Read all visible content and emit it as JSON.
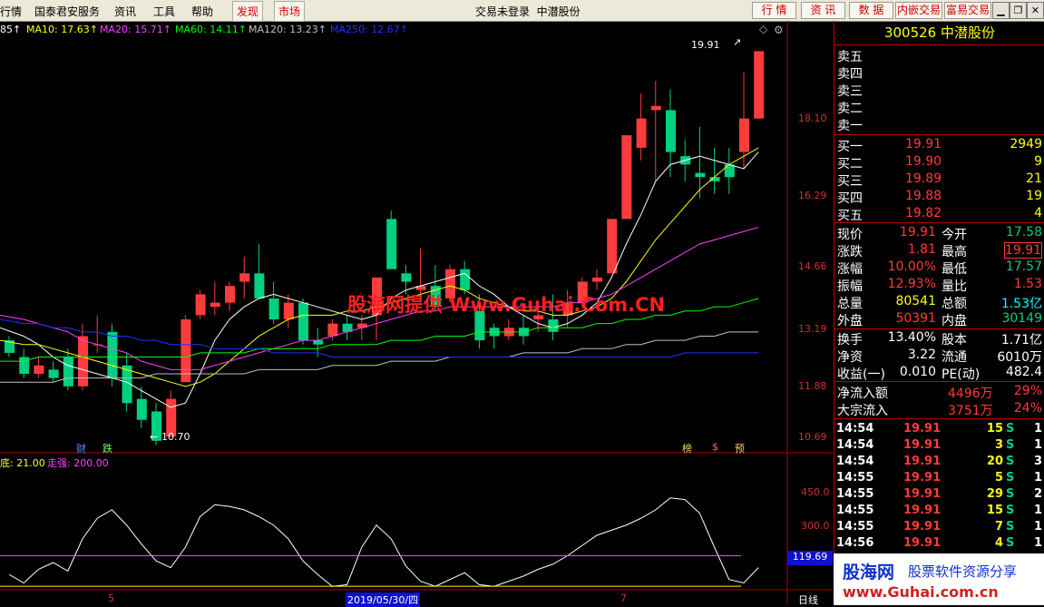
{
  "menu": {
    "items": [
      "行情",
      "国泰君安服务",
      "资讯",
      "工具",
      "帮助"
    ],
    "discover": "发现",
    "market": "市场",
    "title_status": "交易未登录",
    "title_stock": "中潜股份",
    "toolbar": [
      "行 情",
      "资 讯",
      "数 据",
      "内嵌交易",
      "富易交易"
    ]
  },
  "ma_legend": [
    {
      "label": "85↑",
      "color": "#ffffff"
    },
    {
      "label": "MA10: 17.63↑",
      "color": "#ffff00"
    },
    {
      "label": "MA20: 15.71↑",
      "color": "#ff40ff"
    },
    {
      "label": "MA60: 14.11↑",
      "color": "#00ff00"
    },
    {
      "label": "MA120: 13.23↑",
      "color": "#c0c0c0"
    },
    {
      "label": "MA250: 12.67↑",
      "color": "#2030ff"
    }
  ],
  "price_axis": [
    "18.10",
    "16.29",
    "14.66",
    "13.19",
    "11.88",
    "10.69"
  ],
  "annotations": {
    "high": "19.91",
    "low": "10.70",
    "cai": "财",
    "die": "跌",
    "bang": "榜",
    "s": "$",
    "yu": "预"
  },
  "watermark": "股海网提供 Www.Guhai.Com.CN",
  "indicator": {
    "label1": "底: 21.00",
    "label2": "走强: 200.00",
    "axis": [
      "450.0",
      "300.0"
    ],
    "current": "119.69"
  },
  "x_axis": {
    "mark1": "5",
    "date": "2019/05/30/四",
    "mark2": "7",
    "period": "日线"
  },
  "chart_data": {
    "type": "candlestick",
    "ohlc": [
      [
        13.0,
        13.1,
        12.6,
        12.7
      ],
      [
        12.6,
        12.8,
        12.1,
        12.2
      ],
      [
        12.2,
        12.6,
        12.1,
        12.4
      ],
      [
        12.3,
        12.5,
        12.0,
        12.1
      ],
      [
        12.6,
        12.8,
        11.8,
        11.9
      ],
      [
        11.9,
        13.4,
        11.8,
        13.1
      ],
      [
        12.9,
        13.6,
        12.7,
        12.9
      ],
      [
        13.2,
        13.4,
        11.9,
        12.1
      ],
      [
        12.4,
        12.7,
        11.3,
        11.5
      ],
      [
        11.6,
        11.9,
        10.9,
        11.1
      ],
      [
        11.3,
        11.5,
        10.5,
        10.6
      ],
      [
        10.7,
        11.8,
        10.7,
        11.6
      ],
      [
        12.0,
        13.6,
        12.0,
        13.5
      ],
      [
        13.6,
        14.2,
        13.5,
        14.1
      ],
      [
        13.8,
        14.4,
        13.6,
        13.9
      ],
      [
        13.9,
        14.4,
        13.7,
        14.3
      ],
      [
        14.4,
        15.0,
        14.0,
        14.6
      ],
      [
        14.6,
        15.3,
        14.5,
        14.0
      ],
      [
        14.0,
        14.4,
        13.4,
        13.5
      ],
      [
        13.5,
        14.1,
        13.3,
        13.9
      ],
      [
        13.9,
        14.0,
        12.9,
        13.0
      ],
      [
        13.0,
        13.3,
        12.6,
        12.9
      ],
      [
        13.1,
        13.5,
        13.0,
        13.4
      ],
      [
        13.4,
        13.6,
        13.0,
        13.2
      ],
      [
        13.3,
        13.6,
        13.0,
        13.4
      ],
      [
        13.6,
        14.5,
        13.0,
        14.5
      ],
      [
        15.9,
        16.1,
        14.7,
        14.7
      ],
      [
        14.6,
        14.8,
        14.1,
        14.4
      ],
      [
        14.2,
        15.2,
        14.0,
        14.3
      ],
      [
        14.3,
        14.8,
        13.7,
        13.8
      ],
      [
        14.0,
        14.8,
        13.9,
        14.7
      ],
      [
        14.7,
        14.9,
        14.1,
        14.2
      ],
      [
        13.7,
        14.1,
        12.8,
        13.0
      ],
      [
        13.3,
        13.4,
        12.8,
        13.1
      ],
      [
        13.1,
        13.5,
        13.0,
        13.3
      ],
      [
        13.3,
        13.6,
        12.9,
        13.1
      ],
      [
        13.5,
        13.9,
        13.2,
        13.6
      ],
      [
        13.5,
        14.1,
        13.0,
        13.2
      ],
      [
        13.6,
        14.2,
        13.3,
        13.9
      ],
      [
        13.9,
        14.5,
        13.8,
        14.4
      ],
      [
        14.4,
        14.7,
        14.2,
        14.5
      ],
      [
        14.6,
        15.9,
        14.6,
        15.9
      ],
      [
        15.9,
        17.9,
        15.9,
        17.9
      ],
      [
        17.6,
        18.9,
        17.3,
        18.3
      ],
      [
        18.5,
        19.2,
        16.8,
        18.6
      ],
      [
        18.5,
        19.0,
        16.9,
        17.5
      ],
      [
        17.4,
        17.8,
        16.8,
        17.2
      ],
      [
        17.0,
        18.1,
        16.4,
        16.9
      ],
      [
        16.9,
        17.6,
        16.5,
        16.8
      ],
      [
        17.2,
        17.6,
        16.5,
        16.9
      ],
      [
        17.5,
        19.4,
        17.1,
        18.3
      ],
      [
        18.3,
        19.91,
        18.3,
        19.91
      ]
    ],
    "ma_lines": {
      "MA5": [
        13.3,
        13.1,
        12.9,
        12.6,
        12.4,
        12.3,
        12.2,
        12.1,
        12.0,
        11.8,
        11.6,
        11.4,
        11.5,
        12.2,
        13.0,
        13.5,
        13.8,
        14.0,
        14.1,
        14.0,
        13.9,
        13.8,
        13.7,
        13.6,
        13.5,
        13.6,
        14.0,
        14.2,
        14.3,
        14.4,
        14.5,
        14.6,
        14.3,
        14.1,
        13.8,
        13.6,
        13.4,
        13.3,
        13.4,
        13.6,
        13.9,
        14.5,
        15.3,
        16.0,
        16.8,
        17.2,
        17.3,
        17.4,
        17.3,
        17.2,
        17.1,
        17.5
      ],
      "MA10": [
        13.0,
        12.9,
        12.9,
        12.8,
        12.7,
        12.6,
        12.5,
        12.4,
        12.3,
        12.2,
        12.1,
        12.0,
        11.9,
        12.0,
        12.2,
        12.5,
        12.8,
        13.1,
        13.3,
        13.5,
        13.6,
        13.6,
        13.6,
        13.7,
        13.7,
        13.8,
        13.9,
        14.0,
        14.1,
        14.2,
        14.3,
        14.2,
        14.0,
        13.9,
        13.8,
        13.7,
        13.7,
        13.6,
        13.6,
        13.7,
        13.8,
        14.0,
        14.4,
        14.9,
        15.4,
        15.8,
        16.2,
        16.6,
        16.9,
        17.2,
        17.4,
        17.6
      ],
      "MA20": [
        13.6,
        13.5,
        13.4,
        13.3,
        13.2,
        13.0,
        12.9,
        12.8,
        12.7,
        12.5,
        12.4,
        12.3,
        12.3,
        12.3,
        12.4,
        12.5,
        12.6,
        12.7,
        12.8,
        12.9,
        13.0,
        13.0,
        13.1,
        13.2,
        13.3,
        13.4,
        13.5,
        13.6,
        13.7,
        13.7,
        13.8,
        13.8,
        13.8,
        13.8,
        13.8,
        13.8,
        13.8,
        13.8,
        13.9,
        13.9,
        14.0,
        14.1,
        14.3,
        14.5,
        14.7,
        14.9,
        15.1,
        15.3,
        15.4,
        15.5,
        15.6,
        15.7
      ],
      "MA60": [
        12.5,
        12.5,
        12.6,
        12.6,
        12.6,
        12.6,
        12.6,
        12.6,
        12.6,
        12.6,
        12.6,
        12.6,
        12.6,
        12.7,
        12.7,
        12.7,
        12.7,
        12.8,
        12.8,
        12.8,
        12.8,
        12.8,
        12.9,
        12.9,
        12.9,
        12.9,
        13.0,
        13.0,
        13.0,
        13.1,
        13.1,
        13.1,
        13.2,
        13.2,
        13.2,
        13.2,
        13.3,
        13.3,
        13.3,
        13.3,
        13.4,
        13.4,
        13.5,
        13.5,
        13.6,
        13.6,
        13.7,
        13.7,
        13.8,
        13.8,
        13.9,
        14.0
      ],
      "MA120": [
        12.0,
        12.0,
        12.0,
        12.0,
        12.1,
        12.1,
        12.1,
        12.1,
        12.1,
        12.1,
        12.2,
        12.2,
        12.2,
        12.2,
        12.2,
        12.2,
        12.2,
        12.3,
        12.3,
        12.3,
        12.3,
        12.3,
        12.4,
        12.4,
        12.4,
        12.4,
        12.5,
        12.5,
        12.5,
        12.5,
        12.6,
        12.6,
        12.6,
        12.6,
        12.6,
        12.7,
        12.7,
        12.7,
        12.7,
        12.8,
        12.8,
        12.8,
        12.9,
        12.9,
        13.0,
        13.0,
        13.0,
        13.1,
        13.1,
        13.2,
        13.2,
        13.2
      ],
      "MA250": [
        13.5,
        13.4,
        13.4,
        13.3,
        13.3,
        13.2,
        13.2,
        13.1,
        13.1,
        13.0,
        13.0,
        12.9,
        12.9,
        12.9,
        12.8,
        12.8,
        12.8,
        12.8,
        12.7,
        12.7,
        12.7,
        12.7,
        12.6,
        12.6,
        12.6,
        12.6,
        12.6,
        12.6,
        12.6,
        12.6,
        12.6,
        12.6,
        12.6,
        12.6,
        12.6,
        12.6,
        12.6,
        12.6,
        12.6,
        12.6,
        12.6,
        12.6,
        12.6,
        12.6,
        12.6,
        12.6,
        12.7,
        12.7,
        12.7,
        12.7,
        12.7,
        12.7
      ]
    },
    "indicator_values": [
      90,
      40,
      120,
      160,
      110,
      300,
      420,
      470,
      380,
      270,
      170,
      130,
      250,
      430,
      500,
      490,
      470,
      430,
      380,
      300,
      170,
      90,
      20,
      30,
      250,
      380,
      300,
      140,
      50,
      20,
      60,
      100,
      30,
      20,
      50,
      80,
      120,
      150,
      200,
      260,
      320,
      350,
      380,
      420,
      470,
      540,
      530,
      450,
      250,
      60,
      40,
      130
    ],
    "indicator_lines": [
      21,
      200
    ]
  },
  "panel": {
    "code": "300526",
    "name": "中潜股份",
    "asks": [
      "卖五",
      "卖四",
      "卖三",
      "卖二",
      "卖一"
    ],
    "bids": [
      {
        "label": "买一",
        "price": "19.91",
        "vol": "2949"
      },
      {
        "label": "买二",
        "price": "19.90",
        "vol": "9"
      },
      {
        "label": "买三",
        "price": "19.89",
        "vol": "21"
      },
      {
        "label": "买四",
        "price": "19.88",
        "vol": "19"
      },
      {
        "label": "买五",
        "price": "19.82",
        "vol": "4"
      }
    ],
    "stats": [
      {
        "l1": "现价",
        "v1": "19.91",
        "l2": "今开",
        "v2": "17.58"
      },
      {
        "l1": "涨跌",
        "v1": "1.81",
        "l2": "最高",
        "v2": "19.91"
      },
      {
        "l1": "涨幅",
        "v1": "10.00%",
        "l2": "最低",
        "v2": "17.57"
      },
      {
        "l1": "振幅",
        "v1": "12.93%",
        "l2": "量比",
        "v2": "1.53"
      },
      {
        "l1": "总量",
        "v1": "80541",
        "l2": "总额",
        "v2": "1.53亿"
      },
      {
        "l1": "外盘",
        "v1": "50391",
        "l2": "内盘",
        "v2": "30149"
      }
    ],
    "fund": [
      {
        "l1": "换手",
        "v1": "13.40%",
        "l2": "股本",
        "v2": "1.71亿"
      },
      {
        "l1": "净资",
        "v1": "3.22",
        "l2": "流通",
        "v2": "6010万"
      },
      {
        "l1": "收益(一)",
        "v1": "0.010",
        "l2": "PE(动)",
        "v2": "482.4"
      }
    ],
    "flows": [
      {
        "label": "净流入额",
        "val": "4496万",
        "pct": "29%"
      },
      {
        "label": "大宗流入",
        "val": "3751万",
        "pct": "24%"
      }
    ],
    "ticks": [
      {
        "t": "14:54",
        "p": "19.91",
        "v": "15",
        "s": "S",
        "n": "1"
      },
      {
        "t": "14:54",
        "p": "19.91",
        "v": "3",
        "s": "S",
        "n": "1"
      },
      {
        "t": "14:54",
        "p": "19.91",
        "v": "20",
        "s": "S",
        "n": "3"
      },
      {
        "t": "14:55",
        "p": "19.91",
        "v": "5",
        "s": "S",
        "n": "1"
      },
      {
        "t": "14:55",
        "p": "19.91",
        "v": "29",
        "s": "S",
        "n": "2"
      },
      {
        "t": "14:55",
        "p": "19.91",
        "v": "15",
        "s": "S",
        "n": "1"
      },
      {
        "t": "14:55",
        "p": "19.91",
        "v": "7",
        "s": "S",
        "n": "1"
      },
      {
        "t": "14:56",
        "p": "19.91",
        "v": "4",
        "s": "S",
        "n": "1"
      }
    ],
    "ad_line1": "股海网",
    "ad_line1b": "股票软件资源分享",
    "ad_line2": "www.Guhai.com.cn"
  },
  "colors": {
    "up": "#ff3b3b",
    "down": "#00d080",
    "bg": "#000000",
    "accent": "#b00000"
  }
}
